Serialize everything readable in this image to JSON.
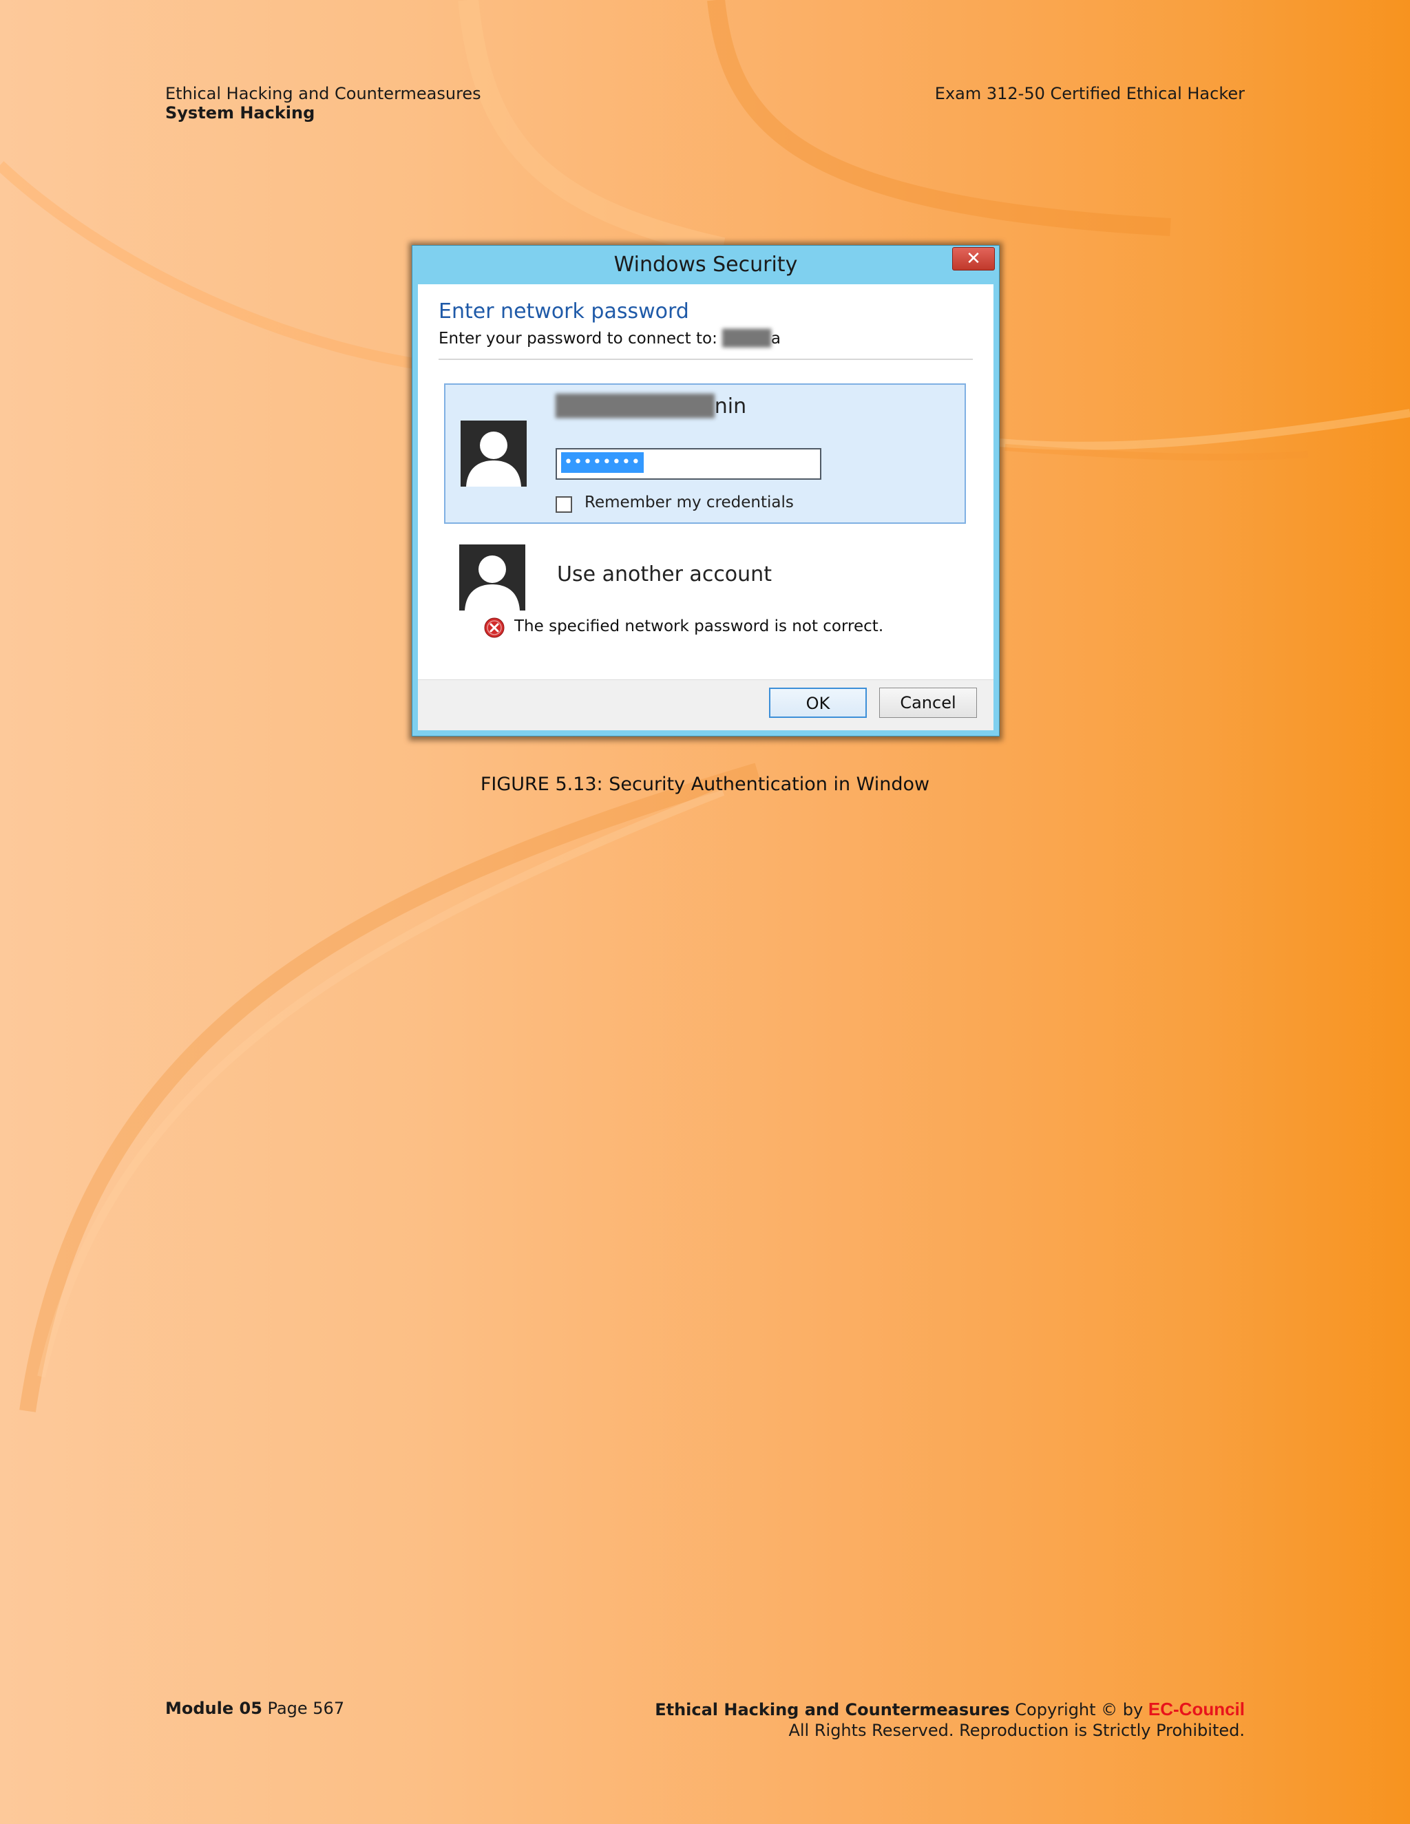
{
  "header": {
    "course_title": "Ethical Hacking and Countermeasures",
    "module_title": "System Hacking",
    "exam_title": "Exam 312-50 Certified Ethical Hacker"
  },
  "dialog": {
    "title": "Windows Security",
    "close_label": "✕",
    "heading": "Enter network password",
    "subtitle": "Enter your password to connect to:",
    "subtitle_target": "a",
    "credential": {
      "username_suffix": "nin",
      "password_mask": "••••••••",
      "remember_label": "Remember my credentials"
    },
    "another_account_label": "Use another account",
    "error_message": "The specified network password is not correct.",
    "ok_label": "OK",
    "cancel_label": "Cancel"
  },
  "figure_caption": "FIGURE 5.13: Security Authentication in Window",
  "footer": {
    "module_label": "Module 05",
    "page_label": "Page 567",
    "course_title": "Ethical Hacking and Countermeasures",
    "copyright_text": "Copyright © by",
    "brand": "EC-Council",
    "rights_text": "All Rights Reserved. Reproduction is Strictly Prohibited."
  },
  "colors": {
    "background_light": "#fdc99a",
    "background_dark": "#f7931f",
    "title_bar": "#7fd0ef",
    "heading_blue": "#1f5aa8",
    "selected_tile": "#dcecfb",
    "brand_red": "#e8141b"
  },
  "icons": [
    "close-icon",
    "user-avatar-icon",
    "error-icon",
    "checkbox-icon"
  ]
}
